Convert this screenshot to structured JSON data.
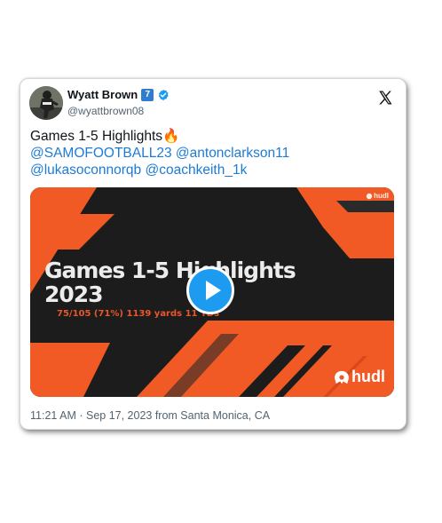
{
  "tweet": {
    "author": {
      "display_name": "Wyatt Brown",
      "badge_number": "7",
      "handle": "@wyattbrown08",
      "verified": true,
      "avatar": "football-player-avatar"
    },
    "platform_icon": "x-logo-icon",
    "text_title": "Games 1-5 Highlights",
    "text_emoji": "🔥",
    "mentions_line1": [
      "@SAMOFOOTBALL23",
      "@antonclarkson11"
    ],
    "mentions_line2": [
      "@lukasoconnorqb",
      "@coachkeith_1k"
    ],
    "timestamp": "11:21 AM · Sep 17, 2023 from Santa Monica, CA"
  },
  "media": {
    "video_title_line1": "Games 1-5 Highlights",
    "video_title_line2": "2023",
    "video_stats": "75/105 (71%) 1139 yards 11 TDs",
    "brand": "hudl",
    "play_icon": "play-icon"
  },
  "colors": {
    "mention": "#1d7bd6",
    "verified": "#1d9bf0",
    "badge": "#2f7dd1",
    "media_dark": "#1c1c1c",
    "media_orange": "#f15a24"
  }
}
